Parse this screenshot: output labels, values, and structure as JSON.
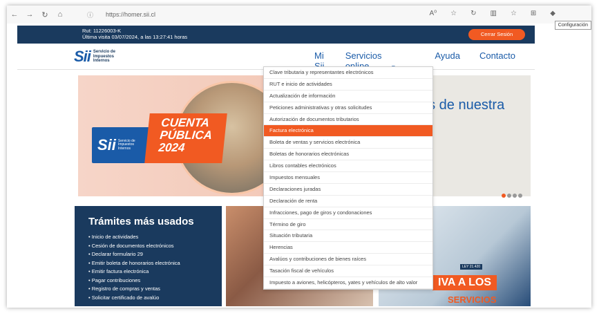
{
  "browser": {
    "url": "https://homer.sii.cl",
    "back": "←",
    "forward": "→",
    "reload": "↻",
    "home": "⌂",
    "right_icons": [
      "A⁰",
      "☆",
      "↻",
      "▥",
      "☆",
      "⊞",
      "◆"
    ],
    "tooltip": "Configuración"
  },
  "top_bar": {
    "rut": "Rut: 11226003-K",
    "last_visit": "Última visita 03/07/2024, a las 13:27:41 horas",
    "logout_label": "Cerrar Sesión"
  },
  "header": {
    "logo_mark": "Sii",
    "logo_text": [
      "Servicio de",
      "Impuestos",
      "Internos"
    ],
    "nav": {
      "mi_sii": "Mi Sii",
      "servicios": "Servicios online",
      "ayuda": "Ayuda",
      "contacto": "Contacto"
    }
  },
  "banner": {
    "cuenta_lines": [
      "CUENTA",
      "PÚBLICA",
      "2024"
    ],
    "badge_mark": "Sii",
    "badge_text": [
      "Servicio de",
      "Impuestos",
      "Internos"
    ],
    "side_text": "es de nuestra"
  },
  "dropdown": {
    "items": [
      "Clave tributaria y representantes electrónicos",
      "RUT e inicio de actividades",
      "Actualización de información",
      "Peticiones administrativas y otras solicitudes",
      "Autorización de documentos tributarios",
      "Factura electrónica",
      "Boleta de ventas y servicios electrónica",
      "Boletas de honorarios electrónicas",
      "Libros contables electrónicos",
      "Impuestos mensuales",
      "Declaraciones juradas",
      "Declaración de renta",
      "Infracciones, pago de giros y condonaciones",
      "Término de giro",
      "Situación tributaria",
      "Herencias",
      "Avalúos y contribuciones de bienes raíces",
      "Tasación fiscal de vehículos",
      "Impuesto a aviones, helicópteros, yates y vehículos de alto valor"
    ],
    "active_index": 5
  },
  "tramites": {
    "title": "Trámites más usados",
    "items": [
      "Inicio de actividades",
      "Cesión de documentos electrónicos",
      "Declarar formulario 29",
      "Emitir boleta de honorarios electrónica",
      "Emitir factura electrónica",
      "Pagar contribuciones",
      "Registro de compras y ventas",
      "Solicitar certificado de avalúo"
    ]
  },
  "promos": {
    "iva": "IVA A LOS",
    "servicios": "SERVICIOS",
    "ley": "LEY 21.420"
  }
}
